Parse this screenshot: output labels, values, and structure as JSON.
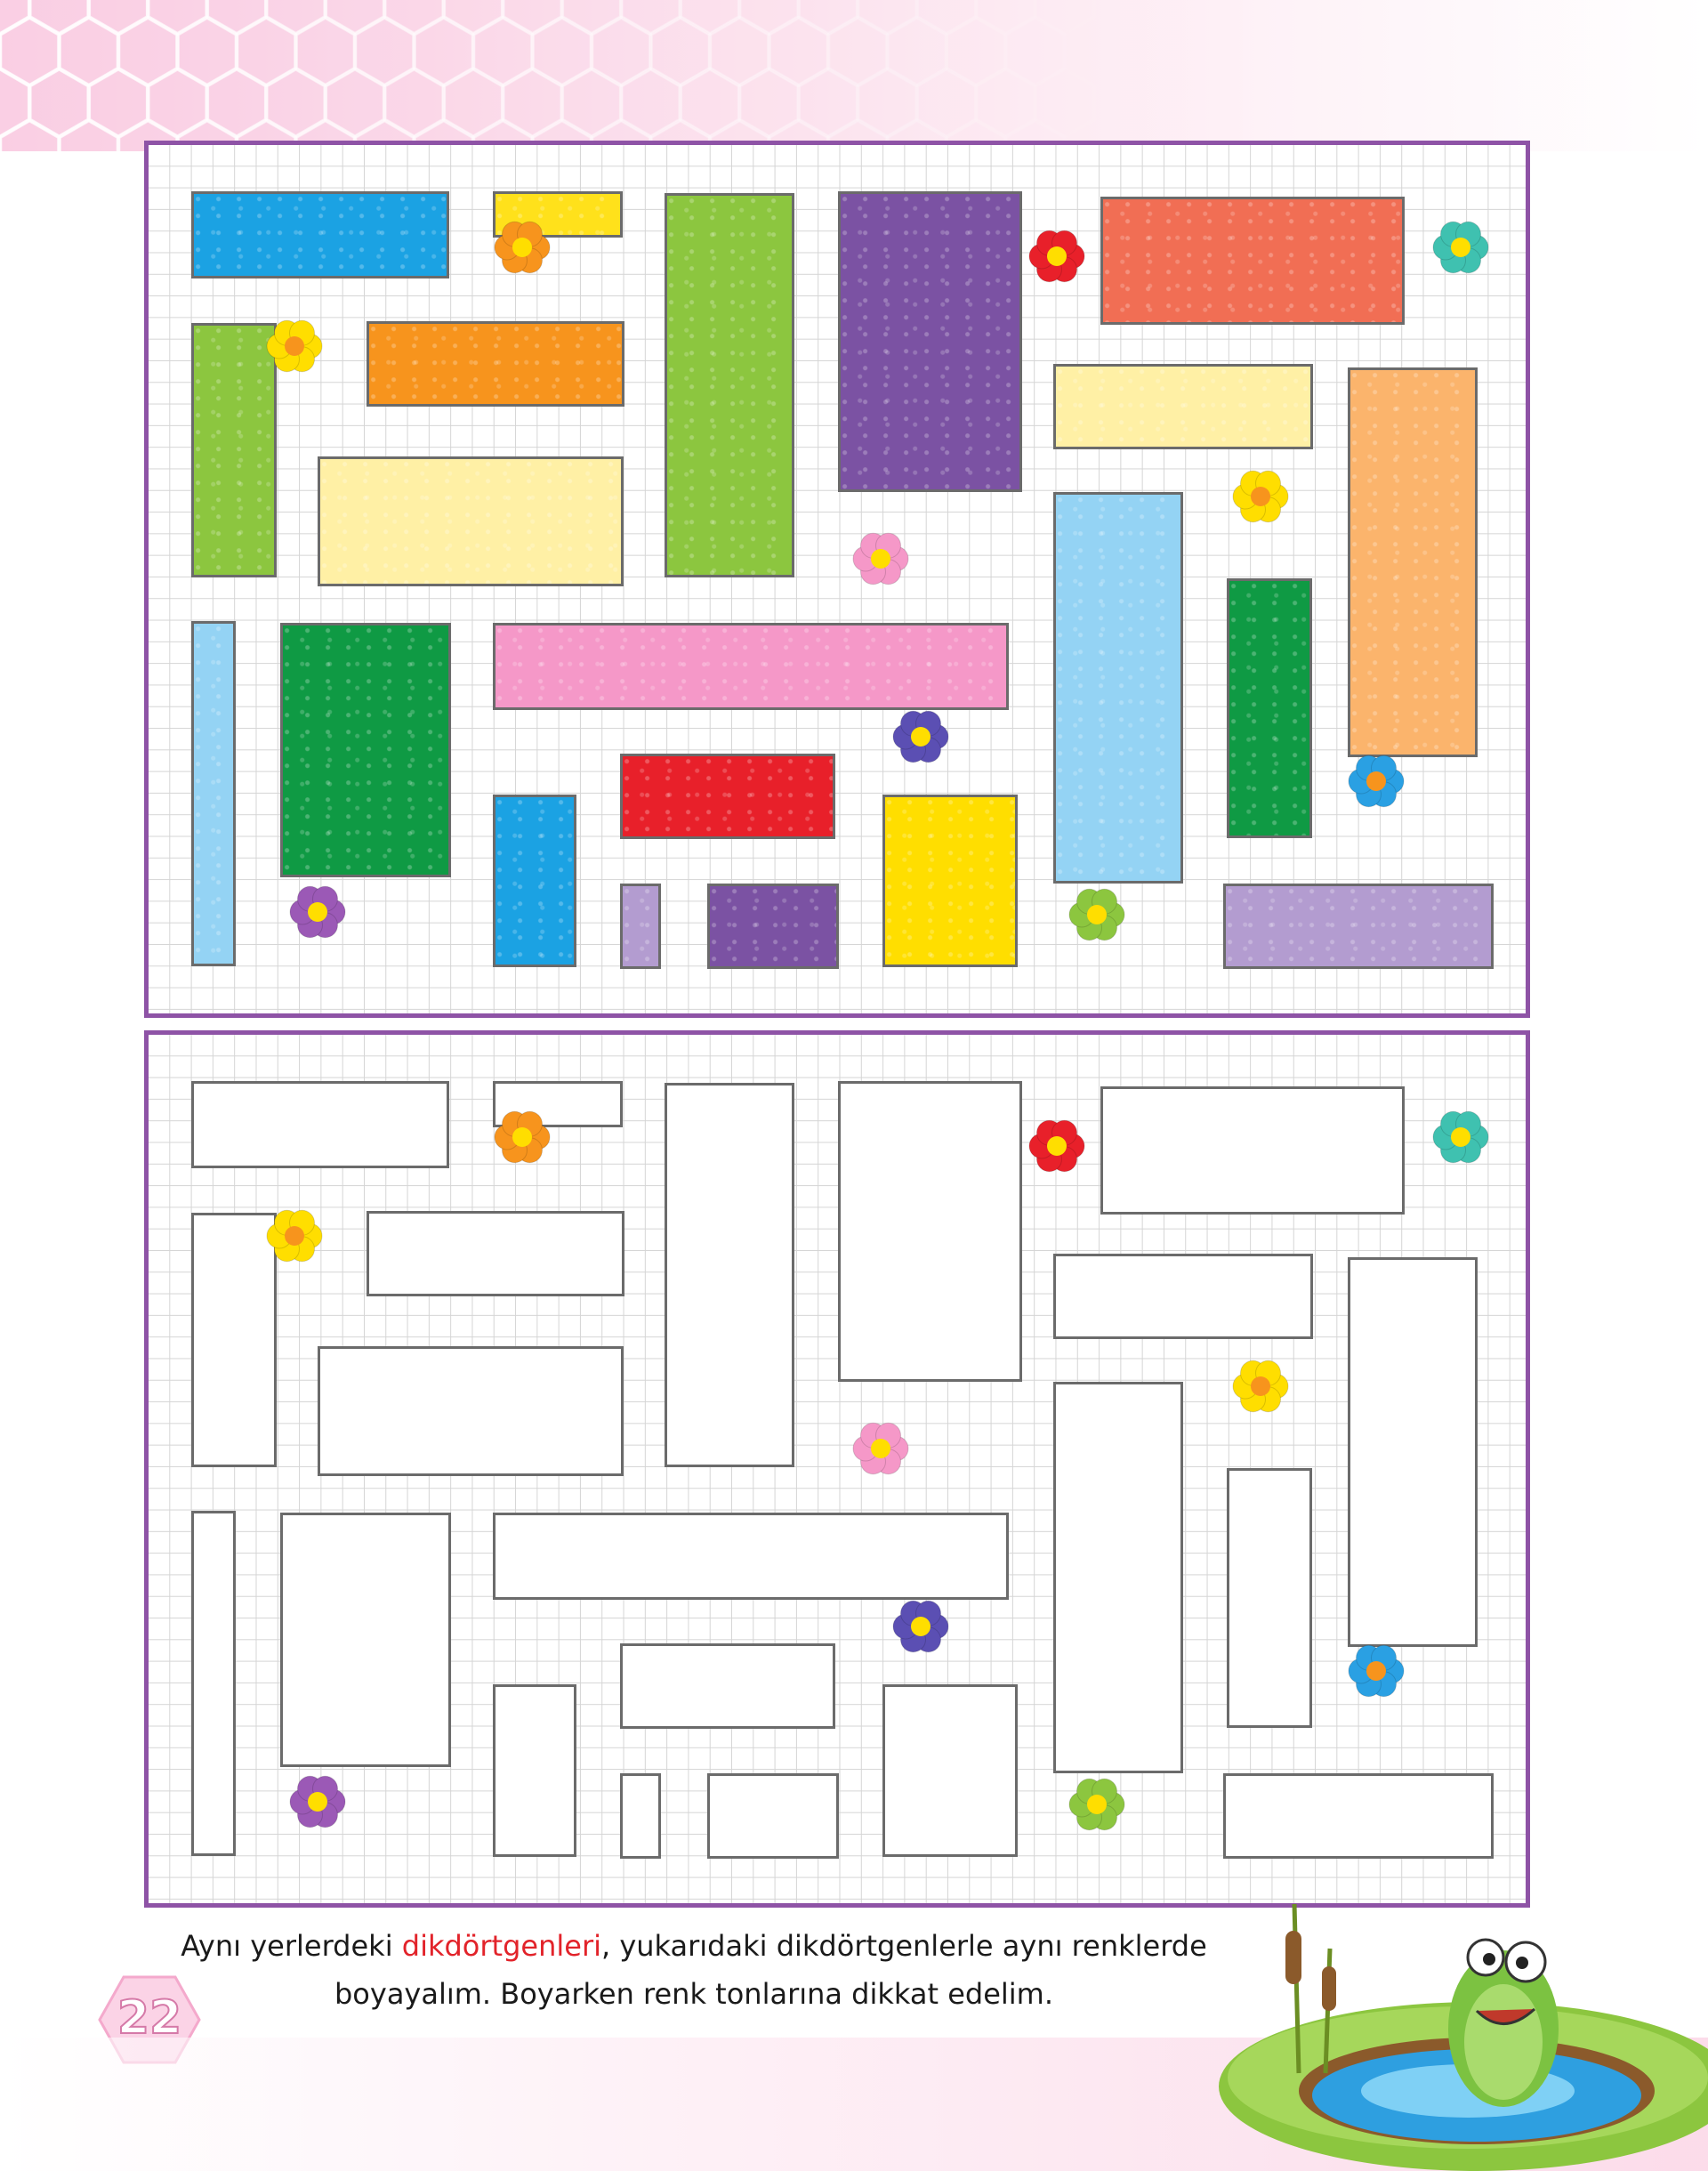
{
  "page": {
    "number": "22",
    "instruction_before": "Aynı yerlerdeki ",
    "instruction_highlight": "dikdörtgenleri",
    "instruction_after": ", yukarıdaki dikdörtgenlerle aynı renklerde",
    "instruction_line2": "boyayalım. Boyarken renk tonlarına dikkat edelim."
  },
  "colors": {
    "frame": "#8e53a6",
    "highlight_text": "#e2232a"
  },
  "rectangles": [
    {
      "id": "r1",
      "color": "#1ba2e3"
    },
    {
      "id": "r2",
      "color": "#ffe11b"
    },
    {
      "id": "r3",
      "color": "#8cc63f"
    },
    {
      "id": "r4",
      "color": "#7b52a3"
    },
    {
      "id": "r5",
      "color": "#f16e54"
    },
    {
      "id": "r6",
      "color": "#8cc63f"
    },
    {
      "id": "r7",
      "color": "#f7941d"
    },
    {
      "id": "r8",
      "color": "#fff0a5"
    },
    {
      "id": "r9",
      "color": "#fff0a5"
    },
    {
      "id": "r10",
      "color": "#fbb46c"
    },
    {
      "id": "r11",
      "color": "#94d3f4"
    },
    {
      "id": "r12",
      "color": "#94d3f4"
    },
    {
      "id": "r13",
      "color": "#0f9a44"
    },
    {
      "id": "r14",
      "color": "#f598c8"
    },
    {
      "id": "r15",
      "color": "#0f9a44"
    },
    {
      "id": "r16",
      "color": "#e8202a"
    },
    {
      "id": "r17",
      "color": "#1ba2e3"
    },
    {
      "id": "r18",
      "color": "#ffde00"
    },
    {
      "id": "r19",
      "color": "#b39cd0"
    },
    {
      "id": "r20",
      "color": "#7b52a3"
    },
    {
      "id": "r21",
      "color": "#b39cd0"
    }
  ],
  "flowers": [
    {
      "id": "f1",
      "petal": "#f7941d",
      "center": "#ffde00",
      "icon": "flower-icon"
    },
    {
      "id": "f2",
      "petal": "#e8202a",
      "center": "#ffde00",
      "icon": "flower-icon"
    },
    {
      "id": "f3",
      "petal": "#3fc1b0",
      "center": "#ffde00",
      "icon": "flower-icon"
    },
    {
      "id": "f4",
      "petal": "#ffde00",
      "center": "#f7941d",
      "icon": "flower-icon"
    },
    {
      "id": "f5",
      "petal": "#f598c8",
      "center": "#ffde00",
      "icon": "flower-icon"
    },
    {
      "id": "f6",
      "petal": "#ffde00",
      "center": "#f7941d",
      "icon": "flower-icon"
    },
    {
      "id": "f7",
      "petal": "#5b4fb3",
      "center": "#ffde00",
      "icon": "flower-icon"
    },
    {
      "id": "f8",
      "petal": "#2aa0e3",
      "center": "#f7941d",
      "icon": "flower-icon"
    },
    {
      "id": "f9",
      "petal": "#9b59b6",
      "center": "#ffde00",
      "icon": "flower-icon"
    },
    {
      "id": "f10",
      "petal": "#8cc63f",
      "center": "#ffde00",
      "icon": "flower-icon"
    }
  ]
}
